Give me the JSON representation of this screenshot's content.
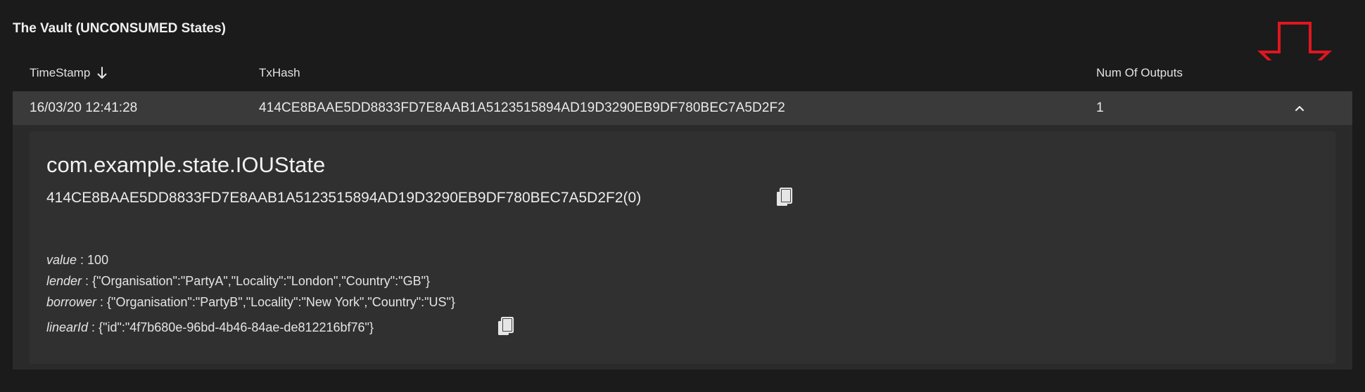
{
  "vault": {
    "title": "The Vault (UNCONSUMED States)"
  },
  "table": {
    "columns": {
      "timestamp": "TimeStamp",
      "txhash": "TxHash",
      "outputs": "Num Of Outputs"
    },
    "sort": {
      "column": "timestamp",
      "direction": "descending",
      "icon": "arrow-down-icon"
    },
    "rows": [
      {
        "timestamp": "16/03/20 12:41:28",
        "txhash": "414CE8BAAE5DD8833FD7E8AAB1A5123515894AD19D3290EB9DF780BEC7A5D2F2",
        "outputs": "1",
        "expanded": true,
        "toggle_icon": "chevron-up-icon"
      }
    ]
  },
  "detail": {
    "state_type": "com.example.state.IOUState",
    "state_ref": "414CE8BAAE5DD8833FD7E8AAB1A5123515894AD19D3290EB9DF780BEC7A5D2F2(0)",
    "copy_icon": "copy-icon",
    "fields": [
      {
        "key": "value",
        "sep": " : ",
        "value": "100"
      },
      {
        "key": "lender",
        "sep": " : ",
        "value": "{\"Organisation\":\"PartyA\",\"Locality\":\"London\",\"Country\":\"GB\"}"
      },
      {
        "key": "borrower",
        "sep": " : ",
        "value": "{\"Organisation\":\"PartyB\",\"Locality\":\"New York\",\"Country\":\"US\"}"
      },
      {
        "key": "linearId",
        "sep": " : ",
        "value": "{\"id\":\"4f7b680e-96bd-4b46-84ae-de812216bf76\"}"
      }
    ]
  },
  "annotation": {
    "icon": "down-arrow-icon",
    "color": "#e0161f"
  },
  "colors": {
    "background": "#1b1b1b",
    "panel": "#2a2a2a",
    "row": "#3a3a3a",
    "card": "#303030",
    "text": "#e6e6e6"
  }
}
